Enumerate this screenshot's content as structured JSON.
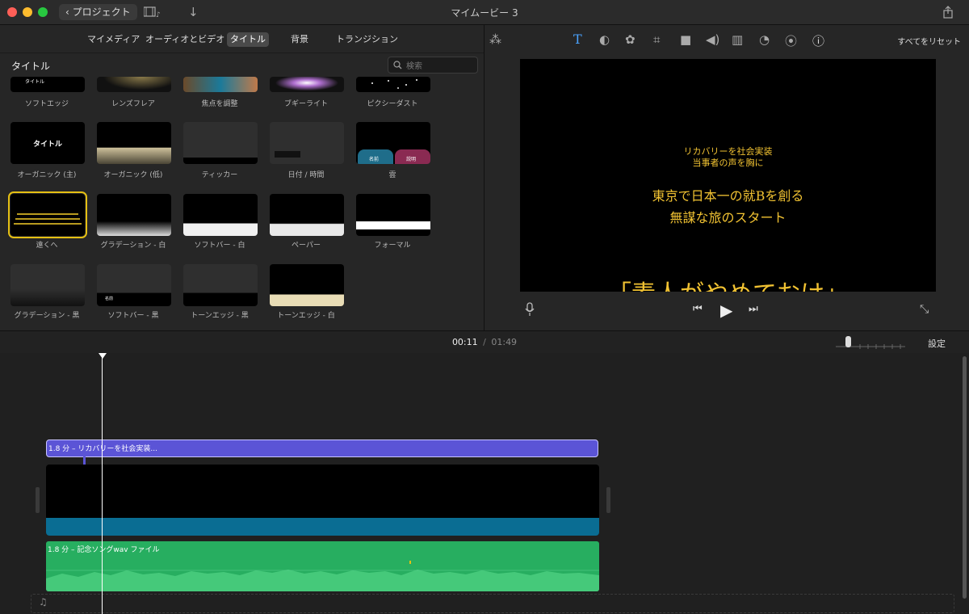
{
  "window": {
    "title": "マイムービー 3",
    "back_label": "プロジェクト"
  },
  "browser": {
    "tabs": [
      {
        "label": "マイメディア",
        "active": false
      },
      {
        "label": "オーディオとビデオ",
        "active": false
      },
      {
        "label": "タイトル",
        "active": true
      },
      {
        "label": "背景",
        "active": false
      },
      {
        "label": "トランジション",
        "active": false
      }
    ],
    "section_title": "タイトル",
    "search_placeholder": "検索",
    "tiles": [
      {
        "label": "ソフトエッジ",
        "thumb_text": "タイトル"
      },
      {
        "label": "レンズフレア"
      },
      {
        "label": "焦点を調整"
      },
      {
        "label": "ブギーライト"
      },
      {
        "label": "ピクシーダスト"
      },
      {
        "label": "オーガニック (主)",
        "thumb_text": "タイトル"
      },
      {
        "label": "オーガニック (低)"
      },
      {
        "label": "ティッカー"
      },
      {
        "label": "日付 / 時間"
      },
      {
        "label": "雲",
        "thumb_text": [
          "名前",
          "説明"
        ]
      },
      {
        "label": "遠くへ",
        "selected": true
      },
      {
        "label": "グラデーション - 白"
      },
      {
        "label": "ソフトバー - 白"
      },
      {
        "label": "ペーパー"
      },
      {
        "label": "フォーマル"
      },
      {
        "label": "グラデーション - 黒"
      },
      {
        "label": "ソフトバー - 黒",
        "thumb_text": "名前"
      },
      {
        "label": "トーンエッジ - 黒"
      },
      {
        "label": "トーンエッジ - 白"
      }
    ]
  },
  "viewer": {
    "reset_label": "すべてをリセット",
    "title_lines": [
      "リカバリーを社会実装",
      "当事者の声を胸に",
      "東京で日本一の就Bを創る",
      "無謀な旅のスタート",
      "「素人がやめておけ」"
    ]
  },
  "timeline": {
    "current_time": "00:11",
    "separator": "/",
    "total_time": "01:49",
    "settings_label": "設定",
    "title_clip_label": "1.8 分 – リカバリーを社会実装...",
    "audio_clip_label": "1.8 分 – 記念ソングwav ファイル"
  },
  "colors": {
    "accent_selected": "#e5c013",
    "title_clip": "#5b54d6",
    "audio_clip": "#27ae60",
    "video_strip": "#0a6d93",
    "overlay_text": "#f1c232"
  },
  "icons": [
    "close-icon",
    "minimize-icon",
    "zoom-icon",
    "chevron-left-icon",
    "film-music-icon",
    "download-icon",
    "share-icon",
    "search-icon",
    "magic-wand-icon",
    "text-icon",
    "color-balance-icon",
    "palette-icon",
    "crop-icon",
    "camera-icon",
    "volume-icon",
    "equalizer-icon",
    "speed-icon",
    "filter-icon",
    "info-icon",
    "microphone-icon",
    "skip-back-icon",
    "play-icon",
    "skip-forward-icon",
    "fullscreen-icon",
    "music-note-icon"
  ]
}
